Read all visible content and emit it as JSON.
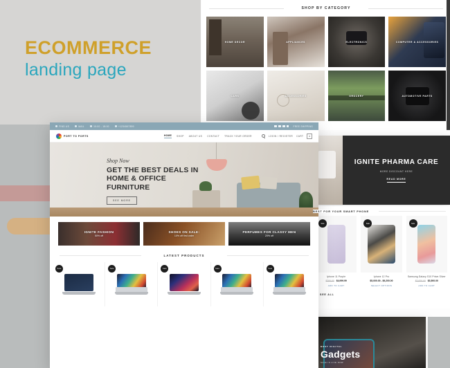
{
  "poster": {
    "title_main": "ECOMMERCE",
    "title_sub": "landing page",
    "color_gold": "#cfa02a",
    "color_teal": "#2aa6bd"
  },
  "category_section": {
    "heading": "SHOP BY CATEGORY",
    "tiles": [
      {
        "label": "HOME DECOR"
      },
      {
        "label": "APPLIANCES"
      },
      {
        "label": "ELECTRONICS"
      },
      {
        "label": "COMPUTER & ACCESSORIES"
      },
      {
        "label": "CARS"
      },
      {
        "label": "ACCESSORIES"
      },
      {
        "label": "GROCERY"
      },
      {
        "label": "AUTOMOTIVE PARTS"
      }
    ]
  },
  "site": {
    "topbar": {
      "find_us": "FIND US",
      "mail": "MAIL",
      "hours": "10:00 - 18:00",
      "phone": "+1234567890",
      "free_shipping": "FREE SHIPPING"
    },
    "brand": "PORT TO PORTS",
    "nav": [
      {
        "label": "HOME",
        "active": true
      },
      {
        "label": "SHOP",
        "active": false
      },
      {
        "label": "ABOUT US",
        "active": false
      },
      {
        "label": "CONTACT",
        "active": false
      },
      {
        "label": "TRACK YOUR ORDER",
        "active": false
      }
    ],
    "account": "LOGIN / REGISTER",
    "cart_label": "CART",
    "cart_count": "0",
    "hero": {
      "script": "Shop Now",
      "title": "GET THE BEST DEALS IN HOME & OFFICE FURNITURE",
      "button": "SEE MORE"
    },
    "promos": [
      {
        "title": "IGNITE FASHION",
        "sub": "50% off"
      },
      {
        "title": "SHOES ON SALE:",
        "sub": "10% off first order"
      },
      {
        "title": "PERFUMES FOR CLASSY MEN",
        "sub": "20% off"
      }
    ],
    "latest_products": {
      "heading": "LATEST PRODUCTS",
      "items": [
        {
          "badge": "Sale"
        },
        {
          "badge": "Sale"
        },
        {
          "badge": "Sale"
        },
        {
          "badge": "Sale"
        },
        {
          "badge": "Sale"
        }
      ]
    }
  },
  "pharma": {
    "title": "IGNITE PHARMA CARE",
    "subtitle": "MORE DISCOUNT HERE",
    "button": "READ MORE"
  },
  "phones": {
    "heading": "BEST FOR YOUR SMART PHONE",
    "see_all": "SEE ALL",
    "items": [
      {
        "badge": "Sale",
        "name": "Iphone 11 Purple",
        "old_price": "$700.00",
        "new_price": "$4,999.99",
        "cta": "ADD TO CART"
      },
      {
        "badge": "Sale",
        "name": "Iphone 12 Pro",
        "old_price": "",
        "new_price": "$5,000.00 - $9,200.00",
        "cta": "SELECT OPTIONS"
      },
      {
        "badge": "Sale",
        "name": "Samsung Galaxy S10 Prism Silver",
        "old_price": "$2,000.00",
        "new_price": "$3,500.00",
        "cta": "ADD TO CART"
      }
    ]
  },
  "gadgets": {
    "kicker": "BEST DIGITAL",
    "title": "Gadgets",
    "sub": "SALE IS LIVE NOW"
  }
}
